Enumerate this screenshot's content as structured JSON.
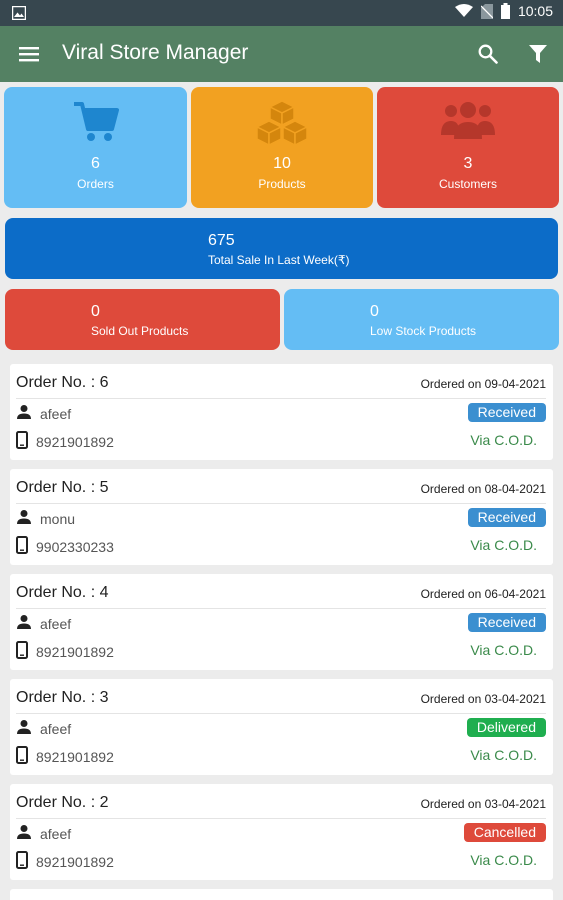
{
  "status_bar": {
    "time": "10:05"
  },
  "app_bar": {
    "title": "Viral Store Manager"
  },
  "tiles": {
    "orders": {
      "count": "6",
      "label": "Orders",
      "color": "#64bdf4",
      "icon": "cart-icon"
    },
    "products": {
      "count": "10",
      "label": "Products",
      "color": "#f2a121",
      "icon": "boxes-icon"
    },
    "customers": {
      "count": "3",
      "label": "Customers",
      "color": "#de4a3b",
      "icon": "people-icon"
    }
  },
  "sale": {
    "value": "675",
    "label": "Total Sale In Last Week(₹)",
    "color": "#0c6cc8"
  },
  "sold_out": {
    "count": "0",
    "label": "Sold Out Products",
    "color": "#de4a3b"
  },
  "low_stock": {
    "count": "0",
    "label": "Low Stock Products",
    "color": "#64bdf4"
  },
  "orders": [
    {
      "title": "Order No. : 6",
      "date": "Ordered on 09-04-2021",
      "customer": "afeef",
      "phone": "8921901892",
      "status": "Received",
      "status_color": "#3b8fd0",
      "payment": "Via C.O.D."
    },
    {
      "title": "Order No. : 5",
      "date": "Ordered on 08-04-2021",
      "customer": "monu",
      "phone": "9902330233",
      "status": "Received",
      "status_color": "#3b8fd0",
      "payment": "Via C.O.D."
    },
    {
      "title": "Order No. : 4",
      "date": "Ordered on 06-04-2021",
      "customer": "afeef",
      "phone": "8921901892",
      "status": "Received",
      "status_color": "#3b8fd0",
      "payment": "Via C.O.D."
    },
    {
      "title": "Order No. : 3",
      "date": "Ordered on 03-04-2021",
      "customer": "afeef",
      "phone": "8921901892",
      "status": "Delivered",
      "status_color": "#1fae4f",
      "payment": "Via C.O.D."
    },
    {
      "title": "Order No. : 2",
      "date": "Ordered on 03-04-2021",
      "customer": "afeef",
      "phone": "8921901892",
      "status": "Cancelled",
      "status_color": "#de4a3b",
      "payment": "Via C.O.D."
    }
  ],
  "icons": {
    "menu": "hamburger-menu-icon",
    "search": "search-icon",
    "filter": "filter-icon",
    "person": "person-icon",
    "phone": "smartphone-icon"
  }
}
